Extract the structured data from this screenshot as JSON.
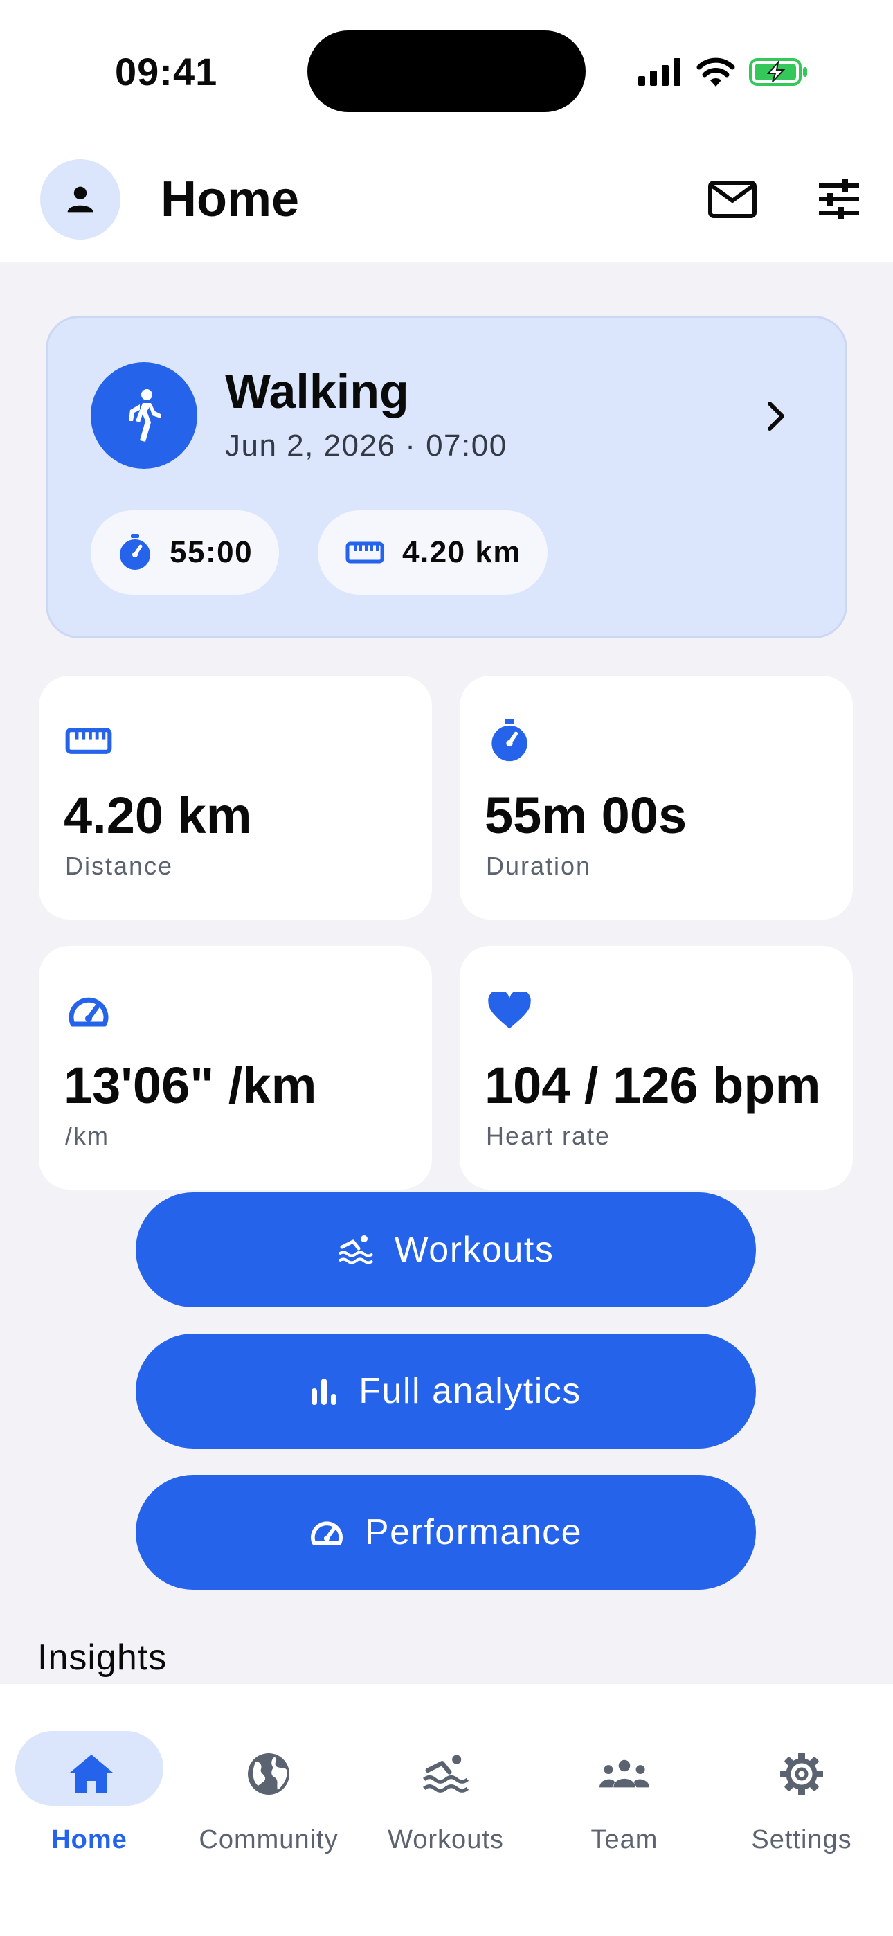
{
  "status_bar": {
    "time": "09:41"
  },
  "header": {
    "title": "Home"
  },
  "activity": {
    "title": "Walking",
    "subtitle": "Jun 2, 2026 · 07:00",
    "chips": [
      {
        "icon": "stopwatch-icon",
        "value": "55:00"
      },
      {
        "icon": "ruler-icon",
        "value": "4.20 km"
      }
    ]
  },
  "stats": [
    {
      "icon": "ruler-icon",
      "value": "4.20 km",
      "label": "Distance"
    },
    {
      "icon": "stopwatch-icon",
      "value": "55m 00s",
      "label": "Duration"
    },
    {
      "icon": "speedometer-icon",
      "value": "13'06\" /km",
      "label": "/km"
    },
    {
      "icon": "heart-icon",
      "value": "104 / 126 bpm",
      "label": "Heart rate"
    }
  ],
  "actions": [
    {
      "icon": "swimmer-icon",
      "label": "Workouts"
    },
    {
      "icon": "bar-chart-icon",
      "label": "Full analytics"
    },
    {
      "icon": "speedometer-icon",
      "label": "Performance"
    }
  ],
  "section": {
    "title": "Insights"
  },
  "tabs": [
    {
      "icon": "home-icon",
      "label": "Home",
      "active": true
    },
    {
      "icon": "globe-icon",
      "label": "Community",
      "active": false
    },
    {
      "icon": "swimmer-icon",
      "label": "Workouts",
      "active": false
    },
    {
      "icon": "team-icon",
      "label": "Team",
      "active": false
    },
    {
      "icon": "gear-icon",
      "label": "Settings",
      "active": false
    }
  ],
  "colors": {
    "accent": "#2563eb",
    "accent_soft": "#dbe5fb",
    "background": "#f2f2f7",
    "battery": "#34c759"
  }
}
